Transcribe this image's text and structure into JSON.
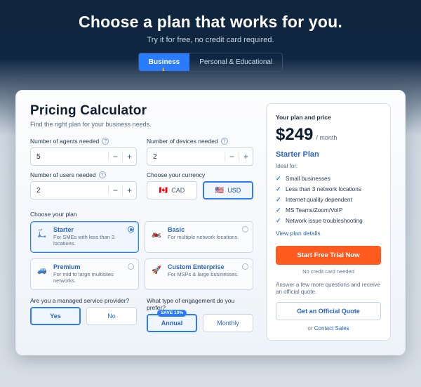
{
  "hero": {
    "title": "Choose a plan that works for you.",
    "subtitle": "Try it for free, no credit card required.",
    "tabs": {
      "business": "Business",
      "personal": "Personal & Educational"
    }
  },
  "calc": {
    "title": "Pricing Calculator",
    "subtitle": "Find the right plan for your business needs.",
    "agents_label": "Number of agents needed",
    "devices_label": "Number of devices needed",
    "users_label": "Number of users needed",
    "currency_label": "Choose your currency",
    "agents_value": "5",
    "devices_value": "2",
    "users_value": "2",
    "currency": {
      "cad": "CAD",
      "usd": "USD"
    },
    "plan_label": "Choose your plan",
    "plans": {
      "starter": {
        "title": "Starter",
        "desc": "For SMEs with less than 3 locations."
      },
      "basic": {
        "title": "Basic",
        "desc": "For multiple network locations."
      },
      "premium": {
        "title": "Premium",
        "desc": "For mid to large multisites networks."
      },
      "custom": {
        "title": "Custom Enterprise",
        "desc": "For MSPs & large businesses."
      }
    },
    "msp_label": "Are you a managed service provider?",
    "engagement_label": "What type of engagement do you prefer?",
    "yes": "Yes",
    "no": "No",
    "annual": "Annual",
    "monthly": "Monthly",
    "save_badge": "SAVE 10%"
  },
  "price": {
    "header": "Your plan and price",
    "amount": "$249",
    "per": "/ month",
    "plan_name": "Starter Plan",
    "ideal": "Ideal for:",
    "features": [
      "Small businesses",
      "Less than 3 network locations",
      "Internet quality dependent",
      "MS Teams/Zoom/VoIP",
      "Network issue troubleshooting"
    ],
    "details_link": "View plan details",
    "cta": "Start Free Trial Now",
    "nocc": "No credit card needed",
    "answer": "Answer a few more questions and receive an official quote.",
    "quote_btn": "Get an Official Quote",
    "or_prefix": "or ",
    "contact": "Contact Sales"
  }
}
